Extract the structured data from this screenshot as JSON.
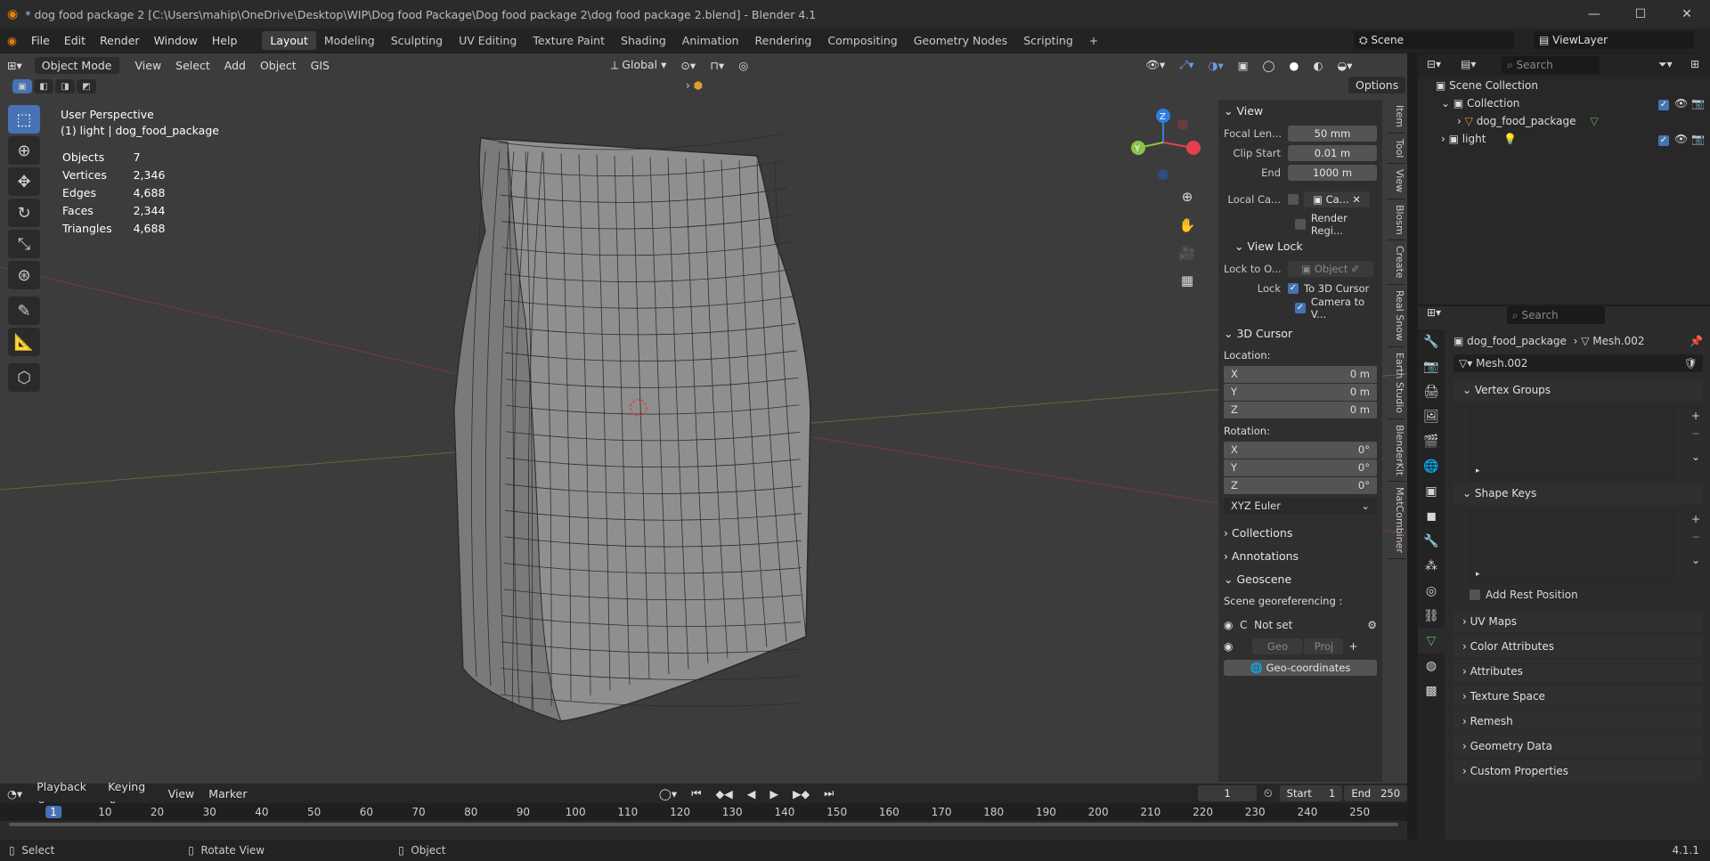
{
  "window": {
    "title": "* dog food package 2 [C:\\Users\\mahip\\OneDrive\\Desktop\\WIP\\Dog food Package\\Dog food package 2\\dog food package 2.blend] - Blender 4.1"
  },
  "menu": [
    "File",
    "Edit",
    "Render",
    "Window",
    "Help"
  ],
  "workspaces": [
    "Layout",
    "Modeling",
    "Sculpting",
    "UV Editing",
    "Texture Paint",
    "Shading",
    "Animation",
    "Rendering",
    "Compositing",
    "Geometry Nodes",
    "Scripting"
  ],
  "active_workspace": "Layout",
  "scene": "Scene",
  "view_layer": "ViewLayer",
  "viewport_header": {
    "mode": "Object Mode",
    "menus": [
      "View",
      "Select",
      "Add",
      "Object",
      "GIS"
    ],
    "transform": "Global",
    "options": "Options"
  },
  "overlay": {
    "perspective": "User Perspective",
    "object": "(1) light | dog_food_package"
  },
  "stats": [
    {
      "label": "Objects",
      "value": "7"
    },
    {
      "label": "Vertices",
      "value": "2,346"
    },
    {
      "label": "Edges",
      "value": "4,688"
    },
    {
      "label": "Faces",
      "value": "2,344"
    },
    {
      "label": "Triangles",
      "value": "4,688"
    }
  ],
  "npanel": {
    "view_title": "View",
    "focal_label": "Focal Len...",
    "focal_value": "50 mm",
    "clip_start_label": "Clip Start",
    "clip_start_value": "0.01 m",
    "end_label": "End",
    "end_value": "1000 m",
    "local_cam_label": "Local Ca...",
    "local_cam_value": "Ca...",
    "render_region": "Render Regi...",
    "view_lock_title": "View Lock",
    "lock_obj_label": "Lock to O...",
    "lock_obj_placeholder": "Object",
    "lock_label": "Lock",
    "to_cursor": "To 3D Cursor",
    "cam_to_view": "Camera to V...",
    "cursor_title": "3D Cursor",
    "location_label": "Location:",
    "location": [
      {
        "axis": "X",
        "value": "0 m"
      },
      {
        "axis": "Y",
        "value": "0 m"
      },
      {
        "axis": "Z",
        "value": "0 m"
      }
    ],
    "rotation_label": "Rotation:",
    "rotation": [
      {
        "axis": "X",
        "value": "0°"
      },
      {
        "axis": "Y",
        "value": "0°"
      },
      {
        "axis": "Z",
        "value": "0°"
      }
    ],
    "rotation_mode": "XYZ Euler",
    "collections": "Collections",
    "annotations": "Annotations",
    "geoscene": "Geoscene",
    "georef_label": "Scene georeferencing :",
    "c_label": "C",
    "not_set": "Not set",
    "geo_btn": "Geo",
    "proj_btn": "Proj",
    "geo_coords": "Geo-coordinates"
  },
  "side_tabs": [
    "Item",
    "Tool",
    "View",
    "Blosm",
    "Create",
    "Real Snow",
    "Earth Studio",
    "BlenderKit",
    "MatCombiner"
  ],
  "outliner": {
    "search_placeholder": "Search",
    "scene_collection": "Scene Collection",
    "collection": "Collection",
    "object1": "dog_food_package",
    "object2": "light"
  },
  "properties": {
    "search_placeholder": "Search",
    "breadcrumb_object": "dog_food_package",
    "breadcrumb_mesh": "Mesh.002",
    "mesh_name": "Mesh.002",
    "vertex_groups": "Vertex Groups",
    "shape_keys": "Shape Keys",
    "add_rest": "Add Rest Position",
    "sections": [
      "UV Maps",
      "Color Attributes",
      "Attributes",
      "Texture Space",
      "Remesh",
      "Geometry Data",
      "Custom Properties"
    ]
  },
  "timeline": {
    "menus": [
      "Playback",
      "Keying",
      "View",
      "Marker"
    ],
    "current_frame": "1",
    "start_label": "Start",
    "start_value": "1",
    "end_label": "End",
    "end_value": "250",
    "ticks": [
      "1",
      "10",
      "20",
      "30",
      "40",
      "50",
      "60",
      "70",
      "80",
      "90",
      "100",
      "110",
      "120",
      "130",
      "140",
      "150",
      "160",
      "170",
      "180",
      "190",
      "200",
      "210",
      "220",
      "230",
      "240",
      "250"
    ]
  },
  "status": {
    "select": "Select",
    "rotate": "Rotate View",
    "object": "Object",
    "version": "4.1.1"
  },
  "colors": {
    "accent": "#4772b3",
    "x_axis": "#e3404f",
    "y_axis": "#8bc34a",
    "z_axis": "#2f7fe0"
  }
}
